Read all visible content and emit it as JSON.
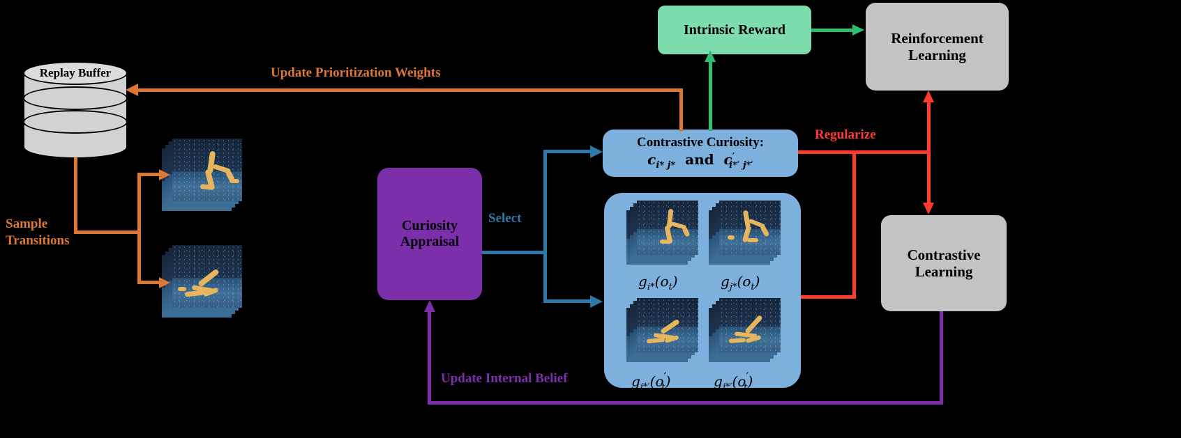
{
  "background_color": "#000000",
  "nodes": {
    "replay_buffer": {
      "label": "Replay Buffer",
      "color": "#d2d2d2"
    },
    "curiosity_appraisal": {
      "line1": "Curiosity",
      "line2": "Appraisal",
      "color": "#7b2fab"
    },
    "contrastive_curiosity": {
      "title": "Contrastive Curiosity:",
      "formula_plain": "c_{i* j*} and c'_{i*' j*'}",
      "color": "#7db0dd"
    },
    "intrinsic_reward": {
      "label": "Intrinsic Reward",
      "color": "#7ddcab"
    },
    "reinforcement_learning": {
      "line1": "Reinforcement",
      "line2": "Learning",
      "color": "#c3c3c3"
    },
    "contrastive_learning": {
      "line1": "Contrastive",
      "line2": "Learning",
      "color": "#c3c3c3"
    }
  },
  "edge_labels": {
    "update_prioritization_weights": {
      "text": "Update Prioritization Weights",
      "color": "#dd7733"
    },
    "sample_transitions": {
      "line1": "Sample",
      "line2": "Transitions",
      "color": "#dd7733"
    },
    "select": {
      "text": "Select",
      "color": "#2d79a8"
    },
    "regularize": {
      "text": "Regularize",
      "color": "#ff3b30"
    },
    "update_internal_belief": {
      "text": "Update Internal Belief",
      "color": "#7b2fab"
    }
  },
  "observation_grid": {
    "panel_color": "#7db0dd",
    "cells": [
      {
        "id": "g-istar-ot",
        "g": "g",
        "sub": "i*",
        "arg": "o",
        "arg_sub": "t",
        "prime": false,
        "arg_prime": false
      },
      {
        "id": "g-jstar-ot",
        "g": "g",
        "sub": "j*",
        "arg": "o",
        "arg_sub": "t",
        "prime": false,
        "arg_prime": false
      },
      {
        "id": "g-istarp-otp",
        "g": "g",
        "sub": "i*′",
        "arg": "o",
        "arg_sub": "t",
        "prime": true,
        "arg_prime": true
      },
      {
        "id": "g-jstarp-otp",
        "g": "g",
        "sub": "j*′",
        "arg": "o",
        "arg_sub": "t",
        "prime": true,
        "arg_prime": true
      }
    ]
  },
  "sampled_observations": [
    {
      "id": "sampled-obs-top",
      "caption": ""
    },
    {
      "id": "sampled-obs-bottom",
      "caption": ""
    }
  ],
  "arrow_colors": {
    "orange": "#dd7733",
    "blue": "#2d79a8",
    "green": "#2fbf71",
    "red": "#ff3b30",
    "purple": "#7b2fab"
  }
}
